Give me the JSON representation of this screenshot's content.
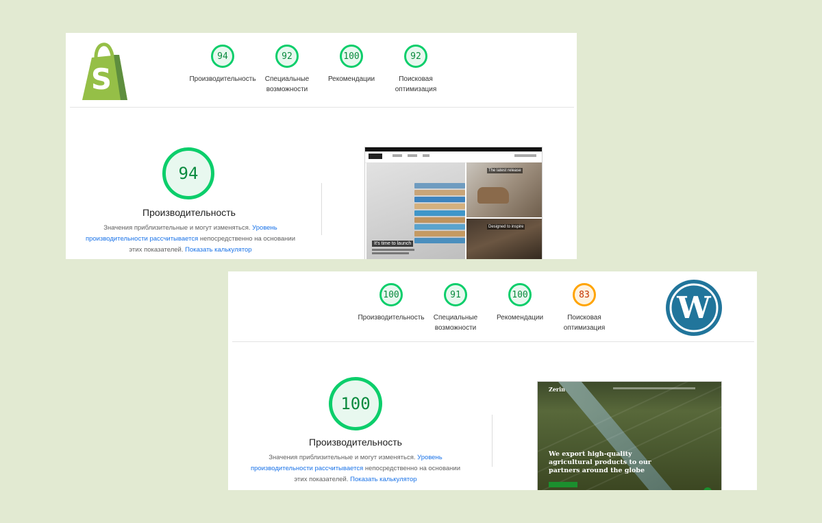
{
  "cards": [
    {
      "platform": "shopify",
      "logo_icon": "shopify-bag-icon",
      "logo_letter": "S",
      "scores": [
        {
          "value": "94",
          "label": "Производительность",
          "color": "green"
        },
        {
          "value": "92",
          "label": "Специальные возможности",
          "color": "green"
        },
        {
          "value": "100",
          "label": "Рекомендации",
          "color": "green"
        },
        {
          "value": "92",
          "label": "Поисковая оптимизация",
          "color": "green"
        }
      ],
      "main_score": "94",
      "main_title": "Производительность",
      "desc_prefix": "Значения приблизительные и могут изменяться. ",
      "desc_link1": "Уровень производительности рассчитывается",
      "desc_mid": " непосредственно на основании этих показателей. ",
      "desc_link2": "Показать калькулятор",
      "thumb": {
        "caption": "It's time to launch",
        "label_top": "The latest release",
        "label_bottom": "Designed to inspire"
      }
    },
    {
      "platform": "wordpress",
      "logo_icon": "wordpress-icon",
      "logo_letter": "W",
      "scores": [
        {
          "value": "100",
          "label": "Производительность",
          "color": "green"
        },
        {
          "value": "91",
          "label": "Специальные возможности",
          "color": "green"
        },
        {
          "value": "100",
          "label": "Рекомендации",
          "color": "green"
        },
        {
          "value": "83",
          "label": "Поисковая оптимизация",
          "color": "orange"
        }
      ],
      "main_score": "100",
      "main_title": "Производительность",
      "desc_prefix": "Значения приблизительные и могут изменяться. ",
      "desc_link1": "Уровень производительности рассчитывается",
      "desc_mid": " непосредственно на основании этих показателей. ",
      "desc_link2": "Показать калькулятор",
      "thumb": {
        "logo": "Zerin",
        "headline": "We export high-quality agricultural products to our partners around the globe"
      }
    }
  ],
  "colors": {
    "background": "#e2ead2",
    "pass": "#0cce6b",
    "average": "#ffa400",
    "link": "#1a73e8",
    "shopify_green": "#95bf47",
    "wordpress_blue": "#21759b"
  }
}
